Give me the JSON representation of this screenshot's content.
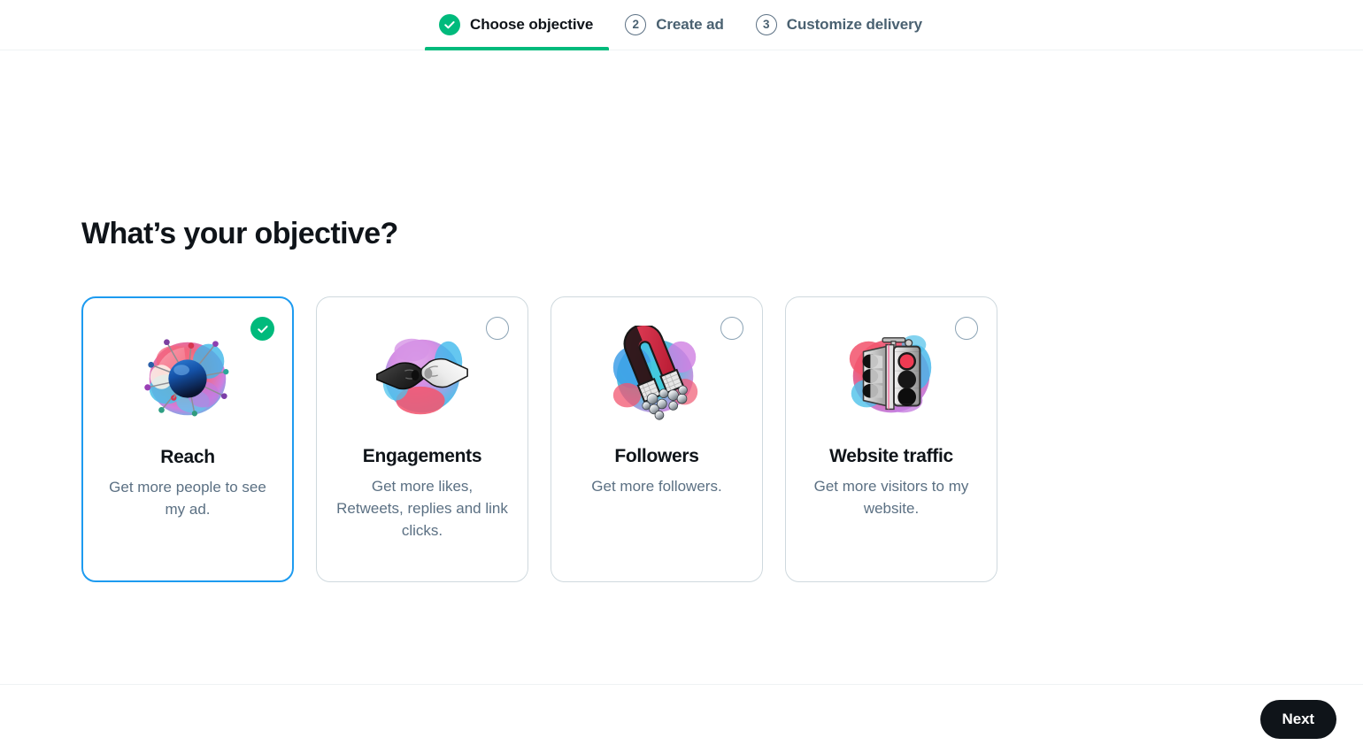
{
  "stepper": {
    "steps": [
      {
        "label": "Choose objective",
        "state": "completed",
        "badge_icon": "check-icon",
        "number": ""
      },
      {
        "label": "Create ad",
        "state": "upcoming",
        "badge_icon": "number-badge",
        "number": "2"
      },
      {
        "label": "Customize delivery",
        "state": "upcoming",
        "badge_icon": "number-badge",
        "number": "3"
      }
    ],
    "active_accent_color": "#00BA7C"
  },
  "main": {
    "title": "What’s your objective?",
    "objectives": [
      {
        "id": "reach",
        "title": "Reach",
        "description": "Get more people to see my ad.",
        "selected": true,
        "illustration": "pin-wheel-target-icon"
      },
      {
        "id": "engagements",
        "title": "Engagements",
        "description": "Get more likes, Retweets, replies and link clicks.",
        "selected": false,
        "illustration": "fist-bump-icon"
      },
      {
        "id": "followers",
        "title": "Followers",
        "description": "Get more followers.",
        "selected": false,
        "illustration": "magnet-icon"
      },
      {
        "id": "website-traffic",
        "title": "Website traffic",
        "description": "Get more visitors to my website.",
        "selected": false,
        "illustration": "traffic-light-icon"
      }
    ]
  },
  "footer": {
    "next_label": "Next"
  },
  "colors": {
    "selected_border": "#1D9BF0",
    "card_border": "#CFD9DE",
    "green_accent": "#00BA7C",
    "text_primary": "#0F1419",
    "text_secondary": "#5B7083",
    "button_bg": "#0F1419"
  }
}
